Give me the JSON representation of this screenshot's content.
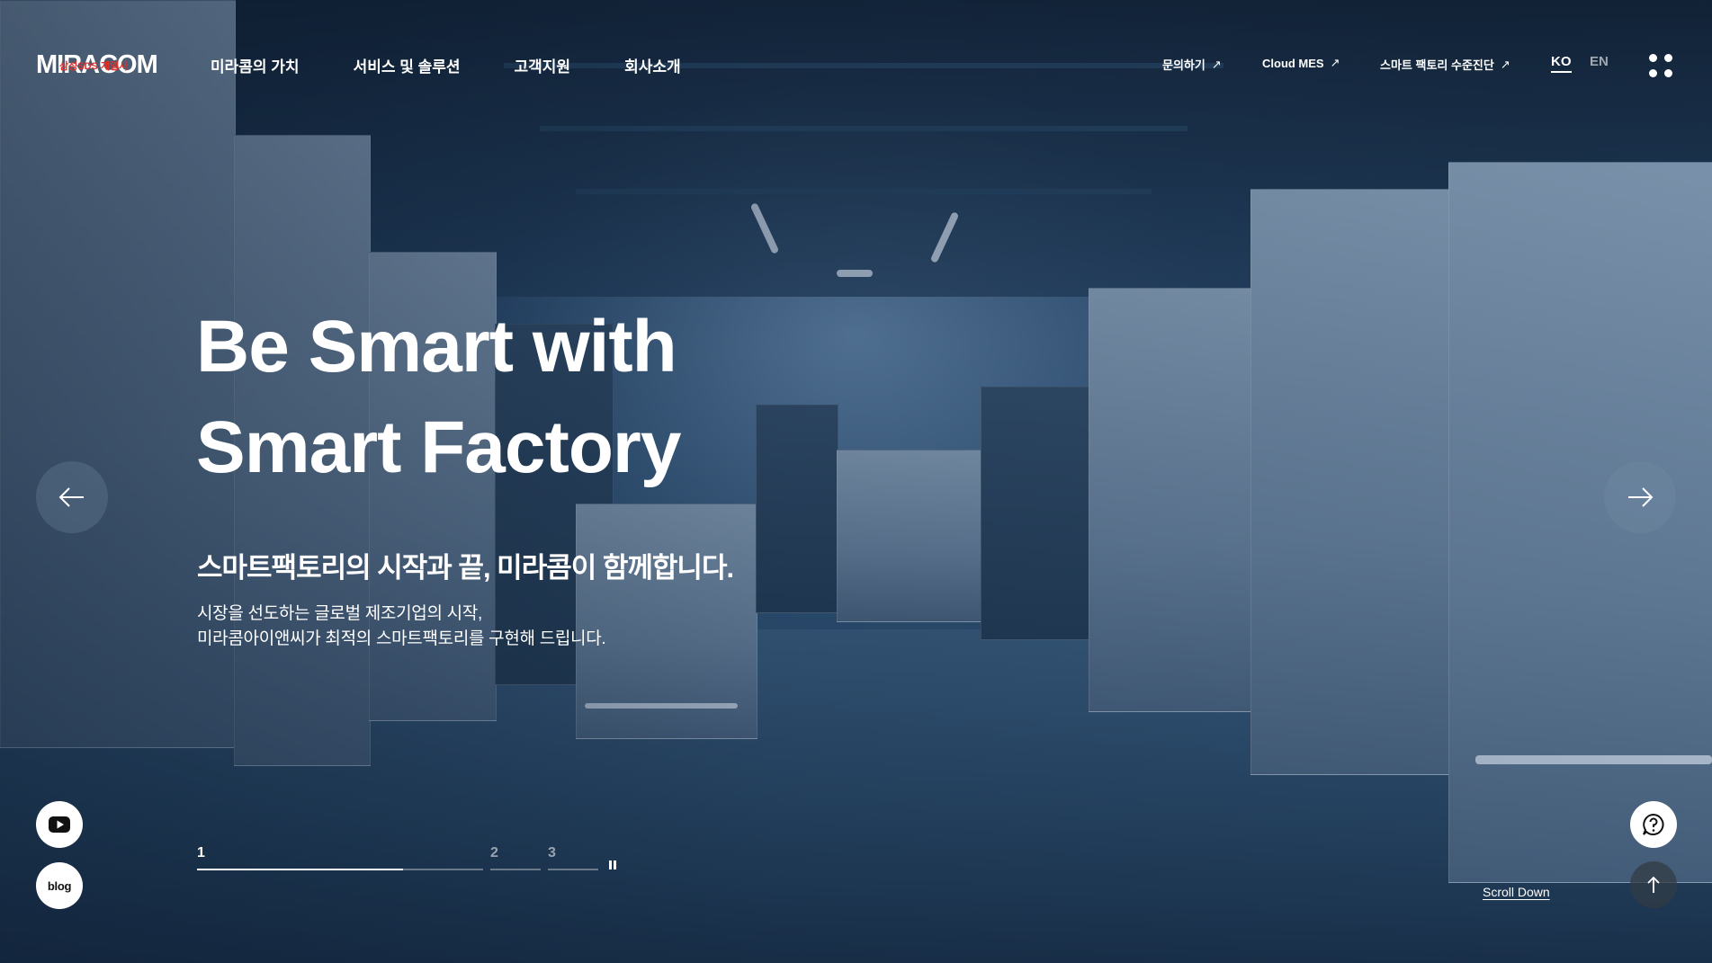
{
  "brand": {
    "logo_text": "MIRACOM",
    "logo_tag": "삼성SDS 계열사",
    "logo_tag_color": "#e0302a"
  },
  "gnb": [
    {
      "label": "미라콤의 가치"
    },
    {
      "label": "서비스 및 솔루션"
    },
    {
      "label": "고객지원"
    },
    {
      "label": "회사소개"
    }
  ],
  "util_links": [
    {
      "label": "문의하기",
      "icon": "arrow-ne-icon",
      "glyph": "↗"
    },
    {
      "label": "Cloud MES",
      "icon": "arrow-ne-icon",
      "glyph": "↗"
    },
    {
      "label": "스마트 팩토리 수준진단",
      "icon": "arrow-ne-icon",
      "glyph": "↗"
    }
  ],
  "language": {
    "ko": "KO",
    "en": "EN",
    "selected": "KO"
  },
  "hero": {
    "headline_line1": "Be Smart with",
    "headline_line2": "Smart Factory",
    "subhead": "스마트팩토리의 시작과 끝, 미라콤이 함께합니다.",
    "desc_line1": "시장을 선도하는 글로벌 제조기업의 시작,",
    "desc_line2": "미라콤아이앤씨가 최적의 스마트팩토리를 구현해 드립니다."
  },
  "slider": {
    "prev_icon": "arrow-left-icon",
    "next_icon": "arrow-right-icon",
    "pages": [
      {
        "label": "1",
        "active": true,
        "progress": 0.72
      },
      {
        "label": "2",
        "active": false,
        "progress": 0
      },
      {
        "label": "3",
        "active": false,
        "progress": 0
      }
    ],
    "pause_icon": "pause-icon"
  },
  "floating": {
    "youtube_icon": "youtube-icon",
    "blog_label": "blog",
    "chat_icon": "question-chat-icon",
    "top_icon": "arrow-up-icon",
    "scroll_down": "Scroll Down"
  },
  "colors": {
    "text": "#ffffff",
    "accent": "#e0302a"
  }
}
